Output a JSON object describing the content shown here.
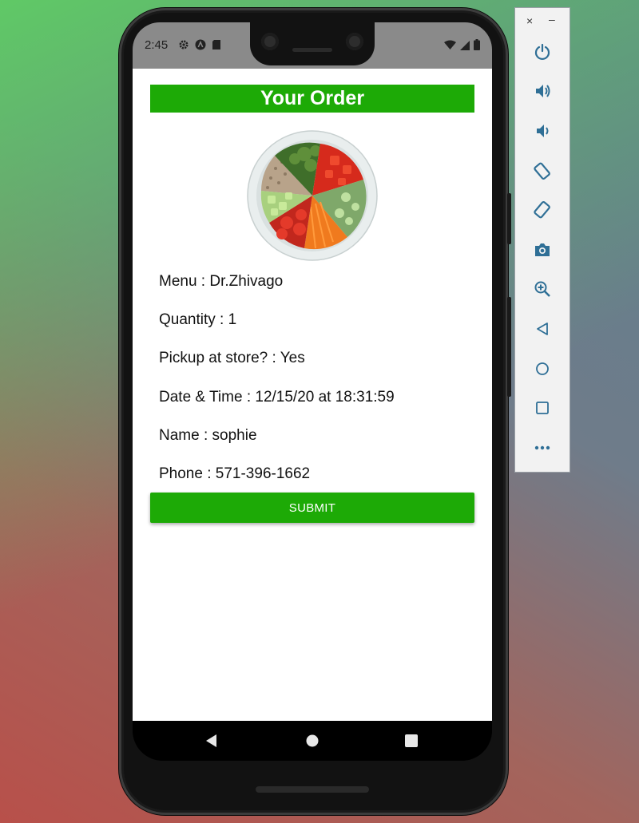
{
  "status_bar": {
    "time": "2:45",
    "left_icons": [
      "gear-icon",
      "a-icon",
      "sd-card-icon"
    ],
    "right_icons": [
      "wifi-icon",
      "signal-icon",
      "battery-icon"
    ]
  },
  "app": {
    "title": "Your Order",
    "image_alt": "salad bowl",
    "details": [
      {
        "label": "Menu : Dr.Zhivago"
      },
      {
        "label": "Quantity : 1"
      },
      {
        "label": "Pickup at store? : Yes"
      },
      {
        "label": "Date & Time : 12/15/20 at 18:31:59"
      },
      {
        "label": "Name : sophie"
      },
      {
        "label": "Phone : 571-396-1662"
      }
    ],
    "submit_label": "SUBMIT"
  },
  "nav_bar": {
    "buttons": [
      "back-icon",
      "home-icon",
      "recents-icon"
    ]
  },
  "emulator": {
    "close_label": "×",
    "minimize_label": "–",
    "controls": [
      "power-icon",
      "volume-up-icon",
      "volume-down-icon",
      "rotate-left-icon",
      "rotate-right-icon",
      "camera-icon",
      "zoom-icon",
      "back-icon",
      "home-icon",
      "overview-icon",
      "more-icon"
    ]
  },
  "colors": {
    "accent": "#1daa06",
    "status_bar": "#8a8a8a",
    "app_background": "#ffffff"
  }
}
